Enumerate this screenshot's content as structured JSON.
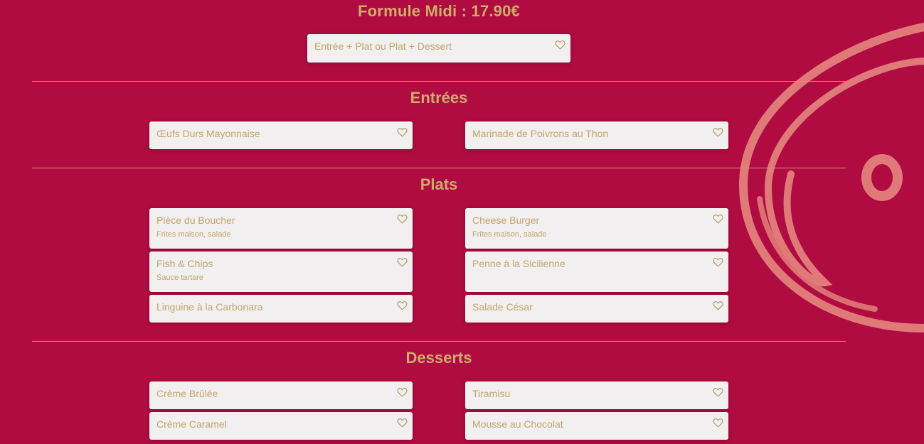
{
  "formule": {
    "title": "Formule Midi : 17.90€",
    "option": "Entrée + Plat ou Plat + Dessert"
  },
  "sections": {
    "entrees": {
      "title": "Entrées",
      "items": [
        {
          "name": "Œufs Durs Mayonnaise",
          "desc": ""
        },
        {
          "name": "Marinade de Poivrons au Thon",
          "desc": ""
        }
      ]
    },
    "plats": {
      "title": "Plats",
      "items": [
        {
          "name": "Pièce du Boucher",
          "desc": "Frites maison, salade"
        },
        {
          "name": "Cheese Burger",
          "desc": "Frites maison, salade"
        },
        {
          "name": "Fish & Chips",
          "desc": "Sauce tartare"
        },
        {
          "name": "Penne à la Sicilienne",
          "desc": ""
        },
        {
          "name": "Linguine à la Carbonara",
          "desc": ""
        },
        {
          "name": "Salade César",
          "desc": ""
        }
      ]
    },
    "desserts": {
      "title": "Desserts",
      "items": [
        {
          "name": "Crème Brûlée",
          "desc": ""
        },
        {
          "name": "Tiramisu",
          "desc": ""
        },
        {
          "name": "Crème Caramel",
          "desc": ""
        },
        {
          "name": "Mousse au Chocolat",
          "desc": ""
        }
      ]
    }
  },
  "icons": {
    "favorite": "heart-outline-icon",
    "decoration": "swirl-logo-decoration"
  },
  "colors": {
    "background": "#b00c42",
    "gold": "#cfac6a",
    "card": "#f2eff0",
    "decoration": "#e07a78"
  }
}
